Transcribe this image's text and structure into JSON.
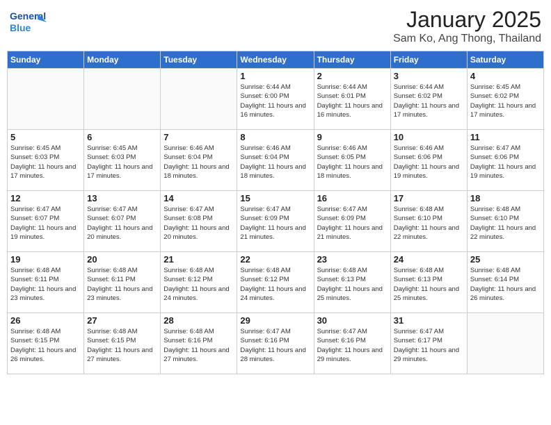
{
  "header": {
    "logo_general": "General",
    "logo_blue": "Blue",
    "month": "January 2025",
    "location": "Sam Ko, Ang Thong, Thailand"
  },
  "days_of_week": [
    "Sunday",
    "Monday",
    "Tuesday",
    "Wednesday",
    "Thursday",
    "Friday",
    "Saturday"
  ],
  "weeks": [
    [
      {
        "day": "",
        "info": ""
      },
      {
        "day": "",
        "info": ""
      },
      {
        "day": "",
        "info": ""
      },
      {
        "day": "1",
        "info": "Sunrise: 6:44 AM\nSunset: 6:00 PM\nDaylight: 11 hours and 16 minutes."
      },
      {
        "day": "2",
        "info": "Sunrise: 6:44 AM\nSunset: 6:01 PM\nDaylight: 11 hours and 16 minutes."
      },
      {
        "day": "3",
        "info": "Sunrise: 6:44 AM\nSunset: 6:02 PM\nDaylight: 11 hours and 17 minutes."
      },
      {
        "day": "4",
        "info": "Sunrise: 6:45 AM\nSunset: 6:02 PM\nDaylight: 11 hours and 17 minutes."
      }
    ],
    [
      {
        "day": "5",
        "info": "Sunrise: 6:45 AM\nSunset: 6:03 PM\nDaylight: 11 hours and 17 minutes."
      },
      {
        "day": "6",
        "info": "Sunrise: 6:45 AM\nSunset: 6:03 PM\nDaylight: 11 hours and 17 minutes."
      },
      {
        "day": "7",
        "info": "Sunrise: 6:46 AM\nSunset: 6:04 PM\nDaylight: 11 hours and 18 minutes."
      },
      {
        "day": "8",
        "info": "Sunrise: 6:46 AM\nSunset: 6:04 PM\nDaylight: 11 hours and 18 minutes."
      },
      {
        "day": "9",
        "info": "Sunrise: 6:46 AM\nSunset: 6:05 PM\nDaylight: 11 hours and 18 minutes."
      },
      {
        "day": "10",
        "info": "Sunrise: 6:46 AM\nSunset: 6:06 PM\nDaylight: 11 hours and 19 minutes."
      },
      {
        "day": "11",
        "info": "Sunrise: 6:47 AM\nSunset: 6:06 PM\nDaylight: 11 hours and 19 minutes."
      }
    ],
    [
      {
        "day": "12",
        "info": "Sunrise: 6:47 AM\nSunset: 6:07 PM\nDaylight: 11 hours and 19 minutes."
      },
      {
        "day": "13",
        "info": "Sunrise: 6:47 AM\nSunset: 6:07 PM\nDaylight: 11 hours and 20 minutes."
      },
      {
        "day": "14",
        "info": "Sunrise: 6:47 AM\nSunset: 6:08 PM\nDaylight: 11 hours and 20 minutes."
      },
      {
        "day": "15",
        "info": "Sunrise: 6:47 AM\nSunset: 6:09 PM\nDaylight: 11 hours and 21 minutes."
      },
      {
        "day": "16",
        "info": "Sunrise: 6:47 AM\nSunset: 6:09 PM\nDaylight: 11 hours and 21 minutes."
      },
      {
        "day": "17",
        "info": "Sunrise: 6:48 AM\nSunset: 6:10 PM\nDaylight: 11 hours and 22 minutes."
      },
      {
        "day": "18",
        "info": "Sunrise: 6:48 AM\nSunset: 6:10 PM\nDaylight: 11 hours and 22 minutes."
      }
    ],
    [
      {
        "day": "19",
        "info": "Sunrise: 6:48 AM\nSunset: 6:11 PM\nDaylight: 11 hours and 23 minutes."
      },
      {
        "day": "20",
        "info": "Sunrise: 6:48 AM\nSunset: 6:11 PM\nDaylight: 11 hours and 23 minutes."
      },
      {
        "day": "21",
        "info": "Sunrise: 6:48 AM\nSunset: 6:12 PM\nDaylight: 11 hours and 24 minutes."
      },
      {
        "day": "22",
        "info": "Sunrise: 6:48 AM\nSunset: 6:12 PM\nDaylight: 11 hours and 24 minutes."
      },
      {
        "day": "23",
        "info": "Sunrise: 6:48 AM\nSunset: 6:13 PM\nDaylight: 11 hours and 25 minutes."
      },
      {
        "day": "24",
        "info": "Sunrise: 6:48 AM\nSunset: 6:13 PM\nDaylight: 11 hours and 25 minutes."
      },
      {
        "day": "25",
        "info": "Sunrise: 6:48 AM\nSunset: 6:14 PM\nDaylight: 11 hours and 26 minutes."
      }
    ],
    [
      {
        "day": "26",
        "info": "Sunrise: 6:48 AM\nSunset: 6:15 PM\nDaylight: 11 hours and 26 minutes."
      },
      {
        "day": "27",
        "info": "Sunrise: 6:48 AM\nSunset: 6:15 PM\nDaylight: 11 hours and 27 minutes."
      },
      {
        "day": "28",
        "info": "Sunrise: 6:48 AM\nSunset: 6:16 PM\nDaylight: 11 hours and 27 minutes."
      },
      {
        "day": "29",
        "info": "Sunrise: 6:47 AM\nSunset: 6:16 PM\nDaylight: 11 hours and 28 minutes."
      },
      {
        "day": "30",
        "info": "Sunrise: 6:47 AM\nSunset: 6:16 PM\nDaylight: 11 hours and 29 minutes."
      },
      {
        "day": "31",
        "info": "Sunrise: 6:47 AM\nSunset: 6:17 PM\nDaylight: 11 hours and 29 minutes."
      },
      {
        "day": "",
        "info": ""
      }
    ]
  ]
}
